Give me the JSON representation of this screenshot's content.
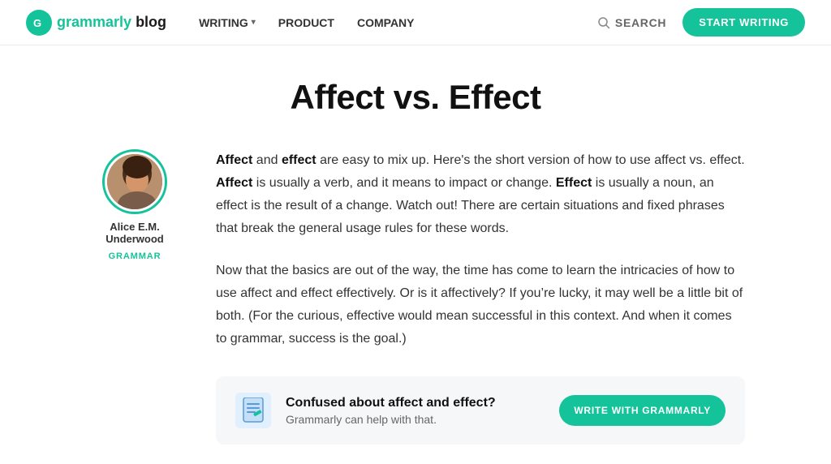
{
  "nav": {
    "logo_letter": "G",
    "logo_brand": "grammarly",
    "logo_suffix": " blog",
    "links": [
      {
        "label": "WRITING",
        "has_dropdown": true
      },
      {
        "label": "PRODUCT",
        "has_dropdown": false
      },
      {
        "label": "COMPANY",
        "has_dropdown": false
      }
    ],
    "search_label": "SEARCH",
    "cta_label": "START WRITING"
  },
  "article": {
    "title": "Affect vs. Effect",
    "author_name": "Alice E.M. Underwood",
    "author_tag": "GRAMMAR",
    "para1": "and effect are easy to mix up. Here’s the short version of how to use affect vs. effect. is usually a verb, and it means to impact or change. is usually a noun, an effect is the result of a change. Watch out! There are certain situations and fixed phrases that break the general usage rules for these words.",
    "para1_bold1": "Affect",
    "para1_bold2": "effect",
    "para1_bold3": "Affect",
    "para1_bold4": "Effect",
    "para2": "Now that the basics are out of the way, the time has come to learn the intricacies of how to use affect and effect effectively. Or is it affectively? If you’re lucky, it may well be a little bit of both. (For the curious, effective would mean successful in this context. And when it comes to grammar, success is the goal.)"
  },
  "promo": {
    "title": "Confused about affect and effect?",
    "subtitle": "Grammarly can help with that.",
    "cta_label": "WRITE WITH GRAMMARLY"
  }
}
